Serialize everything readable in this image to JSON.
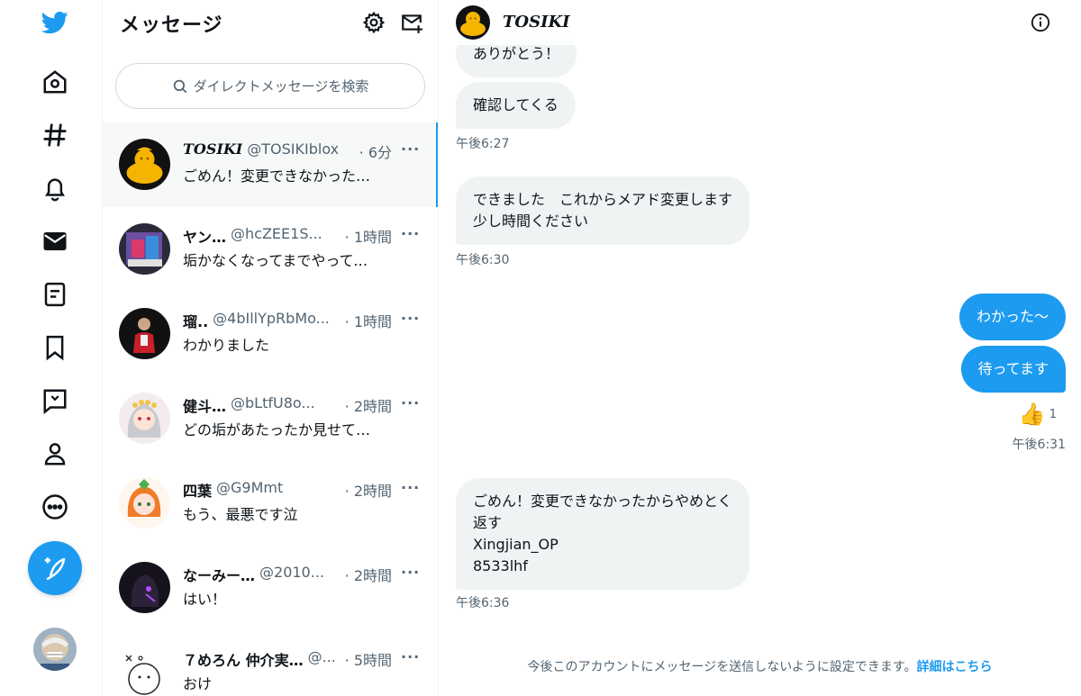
{
  "colors": {
    "accent": "#1d9bf0",
    "bubble_in": "#eff3f4",
    "text_secondary": "#536471"
  },
  "nav": {
    "icons": [
      "twitter-logo-icon",
      "home-icon",
      "explore-hashtag-icon",
      "notifications-bell-icon",
      "messages-envelope-icon",
      "lists-icon",
      "bookmark-icon",
      "twitter-blue-icon",
      "profile-icon",
      "more-circle-icon",
      "compose-tweet-icon"
    ]
  },
  "list": {
    "title": "メッセージ",
    "search_placeholder": "ダイレクトメッセージを検索",
    "conversations": [
      {
        "name": "TOSIKI",
        "handle": "@TOSIKIblox",
        "time": "· 6分",
        "preview": "ごめん！変更できなかったからやめとく",
        "more": "···"
      },
      {
        "name": "ヤン…",
        "handle": "@hcZEE1S...",
        "time": "· 1時間",
        "preview": "垢かなくなってまでやってくれたの",
        "more": "···"
      },
      {
        "name": "瑠..",
        "handle": "@4bIllYpRbMo...",
        "time": "· 1時間",
        "preview": "わかりました",
        "more": "···"
      },
      {
        "name": "健斗…",
        "handle": "@bLtfU8o...",
        "time": "· 2時間",
        "preview": "どの垢があたったか見せてほしい",
        "more": "···"
      },
      {
        "name": "四葉",
        "handle": "@G9Mmt",
        "time": "· 2時間",
        "preview": "もう、最悪です泣",
        "more": "···"
      },
      {
        "name": "なーみー…",
        "handle": "@2010...",
        "time": "· 2時間",
        "preview": "はい！",
        "more": "···"
      },
      {
        "name": "７めろん 仲介実…",
        "handle": "@...",
        "time": "· 5時間",
        "preview": "おけ",
        "more": "···"
      }
    ]
  },
  "chat": {
    "name": "TOSIKI",
    "messages": {
      "m0": "ありがとう！",
      "m1": "確認してくる",
      "ts1": "午後6:27",
      "m2_line1": "できました　これからメアド変更します",
      "m2_line2": "少し時間ください",
      "ts2": "午後6:30",
      "m3": "わかった〜",
      "m4": "待ってます",
      "reaction_emoji": "👍",
      "reaction_count": "1",
      "ts3": "午後6:31",
      "m5_line1": "ごめん！変更できなかったからやめとく",
      "m5_line2": "返す",
      "m5_line3": "Xingjian_OP",
      "m5_line4": "8533lhf",
      "ts4": "午後6:36"
    },
    "footer_note": "今後このアカウントにメッセージを送信しないように設定できます。",
    "footer_link": "詳細はこちら"
  }
}
